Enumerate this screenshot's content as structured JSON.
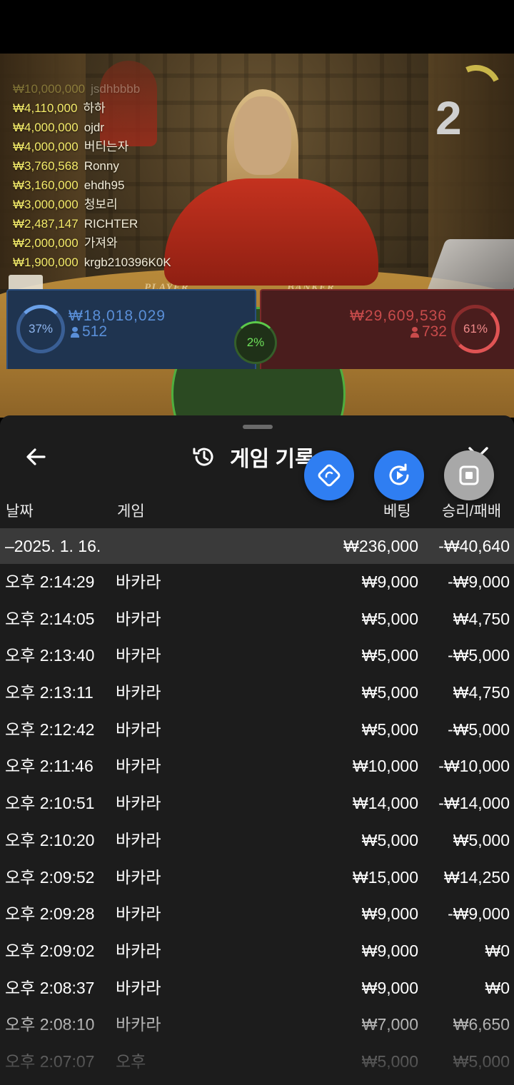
{
  "video": {
    "round_number": "2",
    "table_labels": {
      "player": "PLAYER",
      "banker": "BANKER"
    },
    "winners": [
      {
        "amount": "₩10,000,000",
        "name": "jsdhbbbb",
        "faded": true
      },
      {
        "amount": "₩4,110,000",
        "name": "하하"
      },
      {
        "amount": "₩4,000,000",
        "name": "ojdr"
      },
      {
        "amount": "₩4,000,000",
        "name": "버티는자"
      },
      {
        "amount": "₩3,760,568",
        "name": "Ronny"
      },
      {
        "amount": "₩3,160,000",
        "name": "ehdh95"
      },
      {
        "amount": "₩3,000,000",
        "name": "청보리"
      },
      {
        "amount": "₩2,487,147",
        "name": "RICHTER"
      },
      {
        "amount": "₩2,000,000",
        "name": "가져와"
      },
      {
        "amount": "₩1,900,000",
        "name": "krgb210396K0K"
      }
    ]
  },
  "bets": {
    "player": {
      "percent": "37%",
      "amount": "₩18,018,029",
      "count": "512",
      "color": "#5a8fd8"
    },
    "tie": {
      "percent": "2%",
      "color": "#6ee05a"
    },
    "banker": {
      "percent": "61%",
      "amount": "₩29,609,536",
      "count": "732",
      "color": "#c84b4b"
    }
  },
  "history": {
    "title": "게임 기록",
    "columns": {
      "date": "날짜",
      "game": "게임",
      "bet": "베팅",
      "result": "승리/패배"
    },
    "date_group": {
      "date": "–2025. 1. 16.",
      "bet_total": "₩236,000",
      "result_total": "-₩40,640"
    },
    "rows": [
      {
        "time": "오후 2:14:29",
        "game": "바카라",
        "bet": "₩9,000",
        "result": "-₩9,000"
      },
      {
        "time": "오후 2:14:05",
        "game": "바카라",
        "bet": "₩5,000",
        "result": "₩4,750"
      },
      {
        "time": "오후 2:13:40",
        "game": "바카라",
        "bet": "₩5,000",
        "result": "-₩5,000"
      },
      {
        "time": "오후 2:13:11",
        "game": "바카라",
        "bet": "₩5,000",
        "result": "₩4,750"
      },
      {
        "time": "오후 2:12:42",
        "game": "바카라",
        "bet": "₩5,000",
        "result": "-₩5,000"
      },
      {
        "time": "오후 2:11:46",
        "game": "바카라",
        "bet": "₩10,000",
        "result": "-₩10,000"
      },
      {
        "time": "오후 2:10:51",
        "game": "바카라",
        "bet": "₩14,000",
        "result": "-₩14,000"
      },
      {
        "time": "오후 2:10:20",
        "game": "바카라",
        "bet": "₩5,000",
        "result": "₩5,000"
      },
      {
        "time": "오후 2:09:52",
        "game": "바카라",
        "bet": "₩15,000",
        "result": "₩14,250"
      },
      {
        "time": "오후 2:09:28",
        "game": "바카라",
        "bet": "₩9,000",
        "result": "-₩9,000"
      },
      {
        "time": "오후 2:09:02",
        "game": "바카라",
        "bet": "₩9,000",
        "result": "₩0"
      },
      {
        "time": "오후 2:08:37",
        "game": "바카라",
        "bet": "₩9,000",
        "result": "₩0"
      },
      {
        "time": "오후 2:08:10",
        "game": "바카라",
        "bet": "₩7,000",
        "result": "₩6,650"
      },
      {
        "time": "오후 2:07:07",
        "game": "오후",
        "bet": "₩5,000",
        "result": "₩5,000"
      }
    ]
  },
  "icons": {
    "back": "arrow-left-icon",
    "history": "history-icon",
    "close": "close-icon",
    "fab_rotate": "rotate-icon",
    "fab_replay": "replay-icon",
    "fab_stop": "stop-icon"
  }
}
